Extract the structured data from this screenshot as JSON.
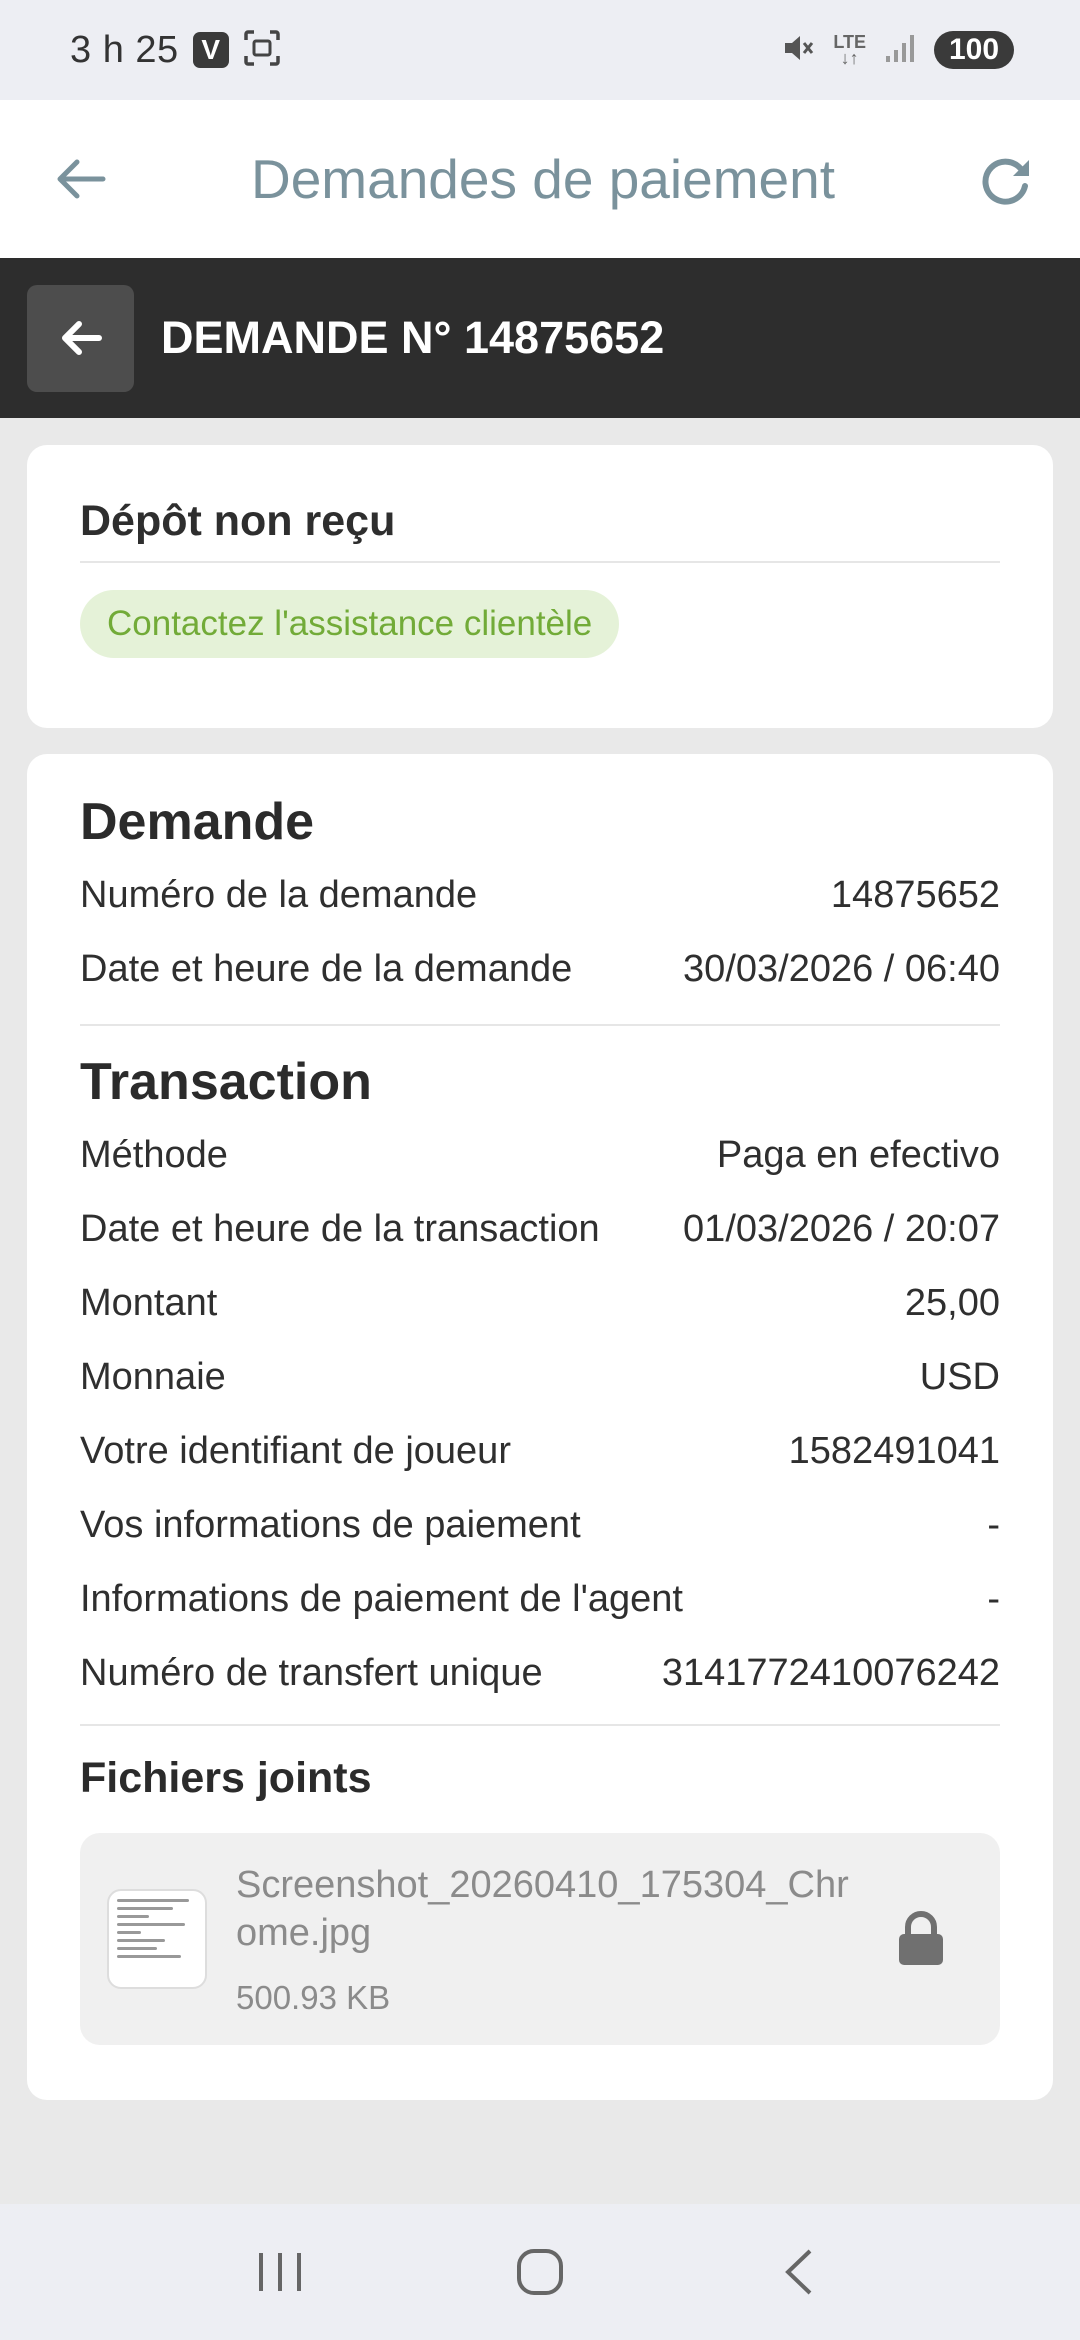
{
  "status_bar": {
    "time": "3 h 25",
    "app_badge": "V",
    "network": "LTE",
    "battery": "100"
  },
  "app_bar": {
    "title": "Demandes de paiement"
  },
  "request_header": {
    "title": "DEMANDE N° 14875652"
  },
  "status_card": {
    "title": "Dépôt non reçu",
    "pill": "Contactez l'assistance clientèle",
    "pill_color": "#72ab38"
  },
  "request_section": {
    "heading": "Demande",
    "rows": [
      {
        "label": "Numéro de la demande",
        "value": "14875652"
      },
      {
        "label": "Date et heure de la demande",
        "value": "30/03/2026 / 06:40"
      }
    ]
  },
  "transaction_section": {
    "heading": "Transaction",
    "rows": [
      {
        "label": "Méthode",
        "value": "Paga en efectivo"
      },
      {
        "label": "Date et heure de la transaction",
        "value": "01/03/2026 / 20:07"
      },
      {
        "label": "Montant",
        "value": "25,00"
      },
      {
        "label": "Monnaie",
        "value": "USD"
      },
      {
        "label": "Votre identifiant de joueur",
        "value": "1582491041"
      },
      {
        "label": "Vos informations de paiement",
        "value": "-"
      },
      {
        "label": "Informations de paiement de l'agent",
        "value": "-"
      },
      {
        "label": "Numéro de transfert unique",
        "value": "3141772410076242"
      }
    ]
  },
  "attachments": {
    "heading": "Fichiers joints",
    "file": {
      "name": "Screenshot_20260410_175304_Chrome.jpg",
      "size": "500.93 KB"
    }
  },
  "icons": {
    "back": "arrow-left-icon",
    "refresh": "refresh-icon",
    "lock": "lock-icon",
    "mute": "mute-icon",
    "signal": "signal-icon",
    "nav_recents": "recents-icon",
    "nav_home": "home-icon",
    "nav_back": "back-chevron-icon"
  }
}
